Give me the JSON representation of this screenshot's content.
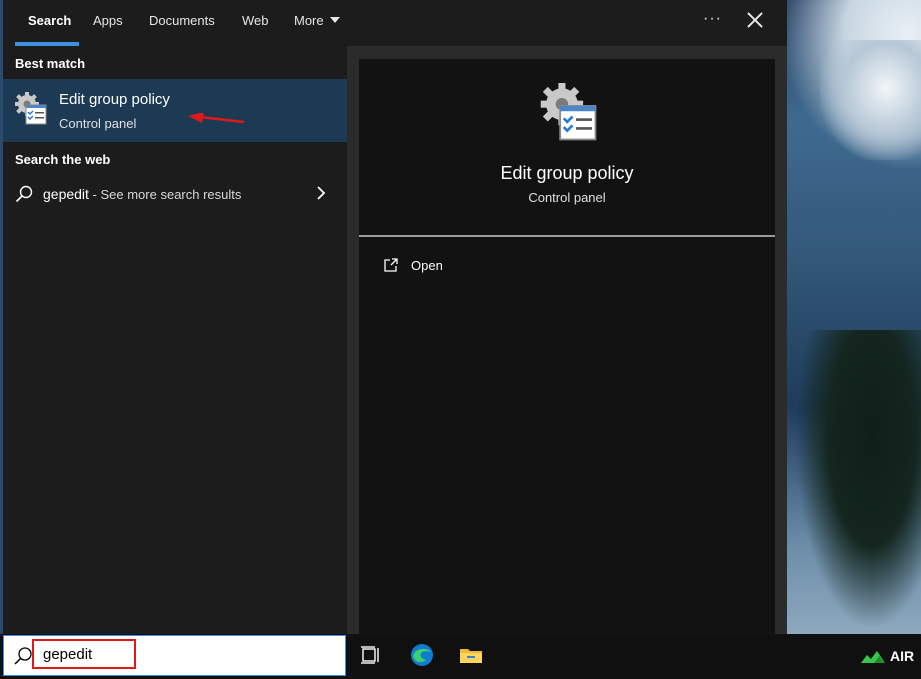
{
  "tabs": [
    {
      "label": "Search",
      "active": true
    },
    {
      "label": "Apps"
    },
    {
      "label": "Documents"
    },
    {
      "label": "Web"
    },
    {
      "label": "More"
    }
  ],
  "header": {
    "more_options": "···"
  },
  "left": {
    "best_match_heading": "Best match",
    "best_match": {
      "title": "Edit group policy",
      "subtitle": "Control panel",
      "icon": "group-policy-icon"
    },
    "web_heading": "Search the web",
    "web_result": {
      "query": "gepedit",
      "suffix": " - See more search results"
    }
  },
  "preview": {
    "title": "Edit group policy",
    "subtitle": "Control panel",
    "actions": [
      {
        "label": "Open",
        "icon": "open-icon"
      }
    ]
  },
  "taskbar": {
    "search_value": "gepedit",
    "tray_label": "AIR"
  },
  "colors": {
    "accent": "#3f8fe0",
    "selected_bg": "#1d3a54",
    "annotation_red": "#e01818"
  }
}
